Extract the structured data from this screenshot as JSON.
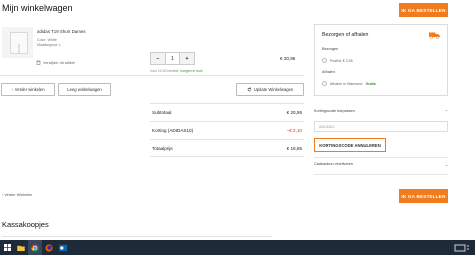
{
  "page": {
    "title": "Mijn winkelwagen"
  },
  "checkout_label": "IK GA BESTELLEN",
  "cart_item": {
    "name": "adidas T19 Short Dames",
    "color": "Color: White",
    "size": "Maatbegroot: L",
    "remove_label": "Verwijder dit artikel",
    "quantity": "1",
    "minus": "−",
    "plus": "+",
    "stock_text": "Voor 22:00 besteld, ",
    "stock_highlight": "morgen in huis",
    "price": "€ 20,95"
  },
  "actions": {
    "continue": "Verder winkelen",
    "empty": "Leeg winkelwagen",
    "update": "Update Winkelwagen"
  },
  "summary": {
    "subtotal_label": "Subtotaal",
    "subtotal_value": "€ 20,95",
    "discount_label": "Korting (ADIDAS10)",
    "discount_value": "−€ 2,10",
    "total_label": "Totaalprijs",
    "total_value": "€ 18,85"
  },
  "shipping": {
    "title": "Bezorgen of afhalen",
    "delivery_label": "Bezorgen",
    "delivery_option": "PostNL € 3,95",
    "pickup_label": "Afhalen",
    "pickup_option": "Afhalen in Warmond",
    "pickup_price": "Gratis"
  },
  "discount": {
    "toggle_label": "Kortingscode toepassen",
    "code_value": "ADIDAS10",
    "cancel_button": "KORTINGSCODE ANNULEREN"
  },
  "gift": {
    "toggle_label": "Cadeaubon verzilveren"
  },
  "back_link": "Verder Winkelen",
  "section2_title": "Kassakoopjes",
  "colors": {
    "accent": "#f07c1e",
    "green": "#3a8f2d",
    "taskbar": "#1e2a38"
  }
}
